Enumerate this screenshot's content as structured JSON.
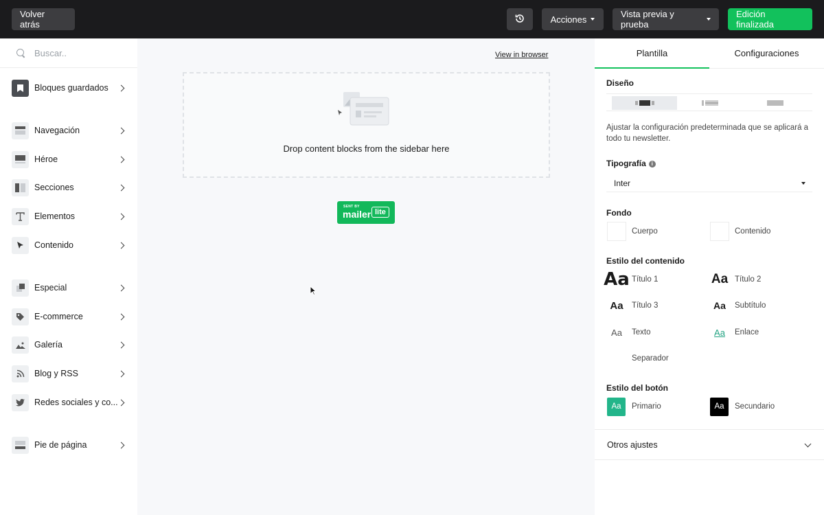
{
  "topbar": {
    "back_label": "Volver atrás",
    "actions_label": "Acciones",
    "preview_label": "Vista previa y prueba",
    "done_label": "Edición finalizada",
    "history_icon": "history-icon",
    "done_color": "#12c15c"
  },
  "sidebar": {
    "search_placeholder": "Buscar..",
    "items": [
      {
        "label": "Bloques guardados",
        "icon": "bookmark-icon"
      },
      {
        "label": "Navegación",
        "icon": "navigation-icon"
      },
      {
        "label": "Héroe",
        "icon": "hero-icon"
      },
      {
        "label": "Secciones",
        "icon": "sections-icon"
      },
      {
        "label": "Elementos",
        "icon": "text-icon"
      },
      {
        "label": "Contenido",
        "icon": "cursor-icon"
      },
      {
        "label": "Especial",
        "icon": "special-icon"
      },
      {
        "label": "E-commerce",
        "icon": "tag-icon"
      },
      {
        "label": "Galería",
        "icon": "image-icon"
      },
      {
        "label": "Blog y RSS",
        "icon": "rss-icon"
      },
      {
        "label": "Redes sociales y co...",
        "icon": "twitter-icon"
      },
      {
        "label": "Pie de página",
        "icon": "footer-icon"
      }
    ]
  },
  "canvas": {
    "view_in_browser": "View in browser",
    "drop_text": "Drop content blocks from the sidebar here",
    "badge_sent_by": "SENT BY",
    "badge_mailer": "mailer",
    "badge_lite": "lite"
  },
  "panel": {
    "tabs": [
      "Plantilla",
      "Configuraciones"
    ],
    "design_heading": "Diseño",
    "design_desc": "Ajustar la configuración predeterminada que se aplicará a todo tu newsletter.",
    "typography_heading": "Tipografía",
    "typography_value": "Inter",
    "background_heading": "Fondo",
    "background_items": [
      "Cuerpo",
      "Contenido"
    ],
    "content_style_heading": "Estilo del contenido",
    "content_styles": [
      {
        "sample": "Aa",
        "label": "Título 1"
      },
      {
        "sample": "Aa",
        "label": "Título 2"
      },
      {
        "sample": "Aa",
        "label": "Título 3"
      },
      {
        "sample": "Aa",
        "label": "Subtítulo"
      },
      {
        "sample": "Aa",
        "label": "Texto"
      },
      {
        "sample": "Aa",
        "label": "Enlace"
      },
      {
        "sample": "",
        "label": "Separador"
      }
    ],
    "button_style_heading": "Estilo del botón",
    "button_styles": [
      {
        "sample": "Aa",
        "label": "Primario",
        "color": "#22b58a"
      },
      {
        "sample": "Aa",
        "label": "Secundario",
        "color": "#000000"
      }
    ],
    "other_settings": "Otros ajustes"
  }
}
